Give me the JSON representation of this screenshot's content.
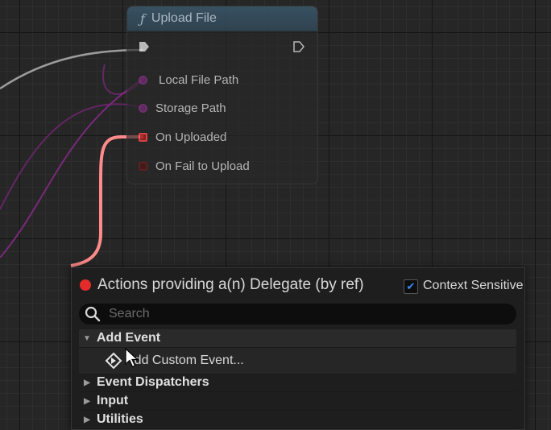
{
  "node": {
    "title": "Upload File",
    "func_icon": "function-icon",
    "pins": {
      "local_file_path": "Local File Path",
      "storage_path": "Storage Path",
      "on_uploaded": "On Uploaded",
      "on_fail": "On Fail to Upload"
    }
  },
  "menu": {
    "title": "Actions providing a(n) Delegate (by ref)",
    "context_sensitive_label": "Context Sensitive",
    "context_sensitive_checked": true,
    "search_placeholder": "Search",
    "categories": [
      {
        "label": "Add Event",
        "expanded": true,
        "items": [
          {
            "label": "Add Custom Event...",
            "icon": "custom-event-icon"
          }
        ]
      },
      {
        "label": "Event Dispatchers",
        "expanded": false
      },
      {
        "label": "Input",
        "expanded": false
      },
      {
        "label": "Utilities",
        "expanded": false
      }
    ]
  },
  "colors": {
    "delegate_wire": "#ff8a8a",
    "purple_wire": "#8a2a8a",
    "exec_wire": "#cfcfcf",
    "record_dot": "#e42b2b",
    "function_header": "#3c5a6e"
  }
}
